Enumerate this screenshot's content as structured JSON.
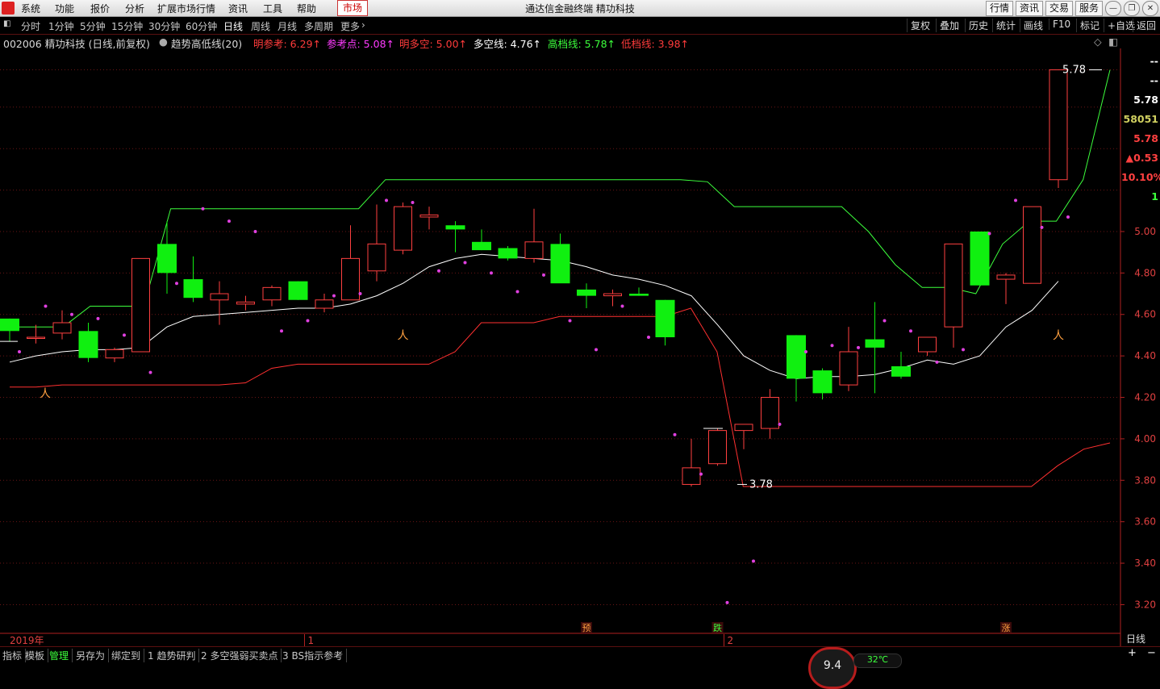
{
  "menubar": {
    "items": [
      "系统",
      "功能",
      "报价",
      "分析",
      "扩展市场行情",
      "资讯",
      "工具",
      "帮助"
    ],
    "market": "市场",
    "title": "通达信金融终端  精功科技",
    "right_buttons": [
      "行情",
      "资讯",
      "交易",
      "服务"
    ]
  },
  "toolbar": {
    "periods": [
      "分时",
      "1分钟",
      "5分钟",
      "15分钟",
      "30分钟",
      "60分钟",
      "日线",
      "周线",
      "月线",
      "多周期",
      "更多"
    ],
    "active_period": "日线",
    "right_items": [
      "复权",
      "叠加",
      "历史",
      "统计",
      "画线",
      "F10",
      "标记",
      "+自选",
      "返回"
    ]
  },
  "infobar": {
    "stock": "002006 精功科技 (日线,前复权)",
    "indicator": "趋势高低线(20)",
    "items": [
      {
        "label": "明参考: 6.29↑",
        "color": "#ff3b3b"
      },
      {
        "label": "参考点: 5.08↑",
        "color": "#ff3bff"
      },
      {
        "label": "明多空: 5.00↑",
        "color": "#ff3b3b"
      },
      {
        "label": "多空线: 4.76↑",
        "color": "#ffffff"
      },
      {
        "label": "高档线: 5.78↑",
        "color": "#3cff3c"
      },
      {
        "label": "低档线: 3.98↑",
        "color": "#ff3b3b"
      }
    ]
  },
  "right_panel": {
    "values": [
      "--",
      "--",
      "5.78",
      "58051",
      "5.78",
      "▲0.53",
      "10.10%",
      "1"
    ],
    "colors": [
      "#ffffff",
      "#ffffff",
      "#ffffff",
      "#d0d060",
      "#ff4040",
      "#ff4040",
      "#ff4040",
      "#3cff3c"
    ]
  },
  "chart_data": {
    "type": "candlestick",
    "ylim": [
      3.12,
      5.86
    ],
    "yticks": [
      "5.00",
      "4.80",
      "4.60",
      "4.40",
      "4.20",
      "4.00",
      "3.80",
      "3.60",
      "3.40",
      "3.20"
    ],
    "ytick_values": [
      5.0,
      4.8,
      4.6,
      4.4,
      4.2,
      4.0,
      3.8,
      3.6,
      3.4,
      3.2
    ],
    "xlabels": [
      "2019年",
      "1",
      "2"
    ],
    "xlabel_candles": [
      0,
      11,
      27
    ],
    "event_markers": [
      {
        "text": "预",
        "candle": 22
      },
      {
        "text": "跌",
        "candle": 27
      },
      {
        "text": "涨",
        "candle": 38
      }
    ],
    "max_label": "5.78",
    "min_label": "3.78",
    "candles": [
      {
        "o": 4.58,
        "h": 4.58,
        "l": 4.47,
        "c": 4.52
      },
      {
        "o": 4.49,
        "h": 4.55,
        "l": 4.46,
        "c": 4.49
      },
      {
        "o": 4.51,
        "h": 4.62,
        "l": 4.48,
        "c": 4.56
      },
      {
        "o": 4.52,
        "h": 4.56,
        "l": 4.37,
        "c": 4.39
      },
      {
        "o": 4.39,
        "h": 4.44,
        "l": 4.37,
        "c": 4.43
      },
      {
        "o": 4.42,
        "h": 4.87,
        "l": 4.42,
        "c": 4.87
      },
      {
        "o": 4.94,
        "h": 5.05,
        "l": 4.7,
        "c": 4.8
      },
      {
        "o": 4.77,
        "h": 4.88,
        "l": 4.66,
        "c": 4.68
      },
      {
        "o": 4.67,
        "h": 4.76,
        "l": 4.55,
        "c": 4.7
      },
      {
        "o": 4.65,
        "h": 4.69,
        "l": 4.62,
        "c": 4.66
      },
      {
        "o": 4.67,
        "h": 4.74,
        "l": 4.64,
        "c": 4.73
      },
      {
        "o": 4.76,
        "h": 4.76,
        "l": 4.67,
        "c": 4.67
      },
      {
        "o": 4.63,
        "h": 4.7,
        "l": 4.61,
        "c": 4.67
      },
      {
        "o": 4.67,
        "h": 5.03,
        "l": 4.67,
        "c": 4.87
      },
      {
        "o": 4.81,
        "h": 5.13,
        "l": 4.76,
        "c": 4.94
      },
      {
        "o": 4.91,
        "h": 5.14,
        "l": 4.89,
        "c": 5.12
      },
      {
        "o": 5.07,
        "h": 5.12,
        "l": 5.01,
        "c": 5.08
      },
      {
        "o": 5.03,
        "h": 5.05,
        "l": 4.9,
        "c": 5.01
      },
      {
        "o": 4.95,
        "h": 5.01,
        "l": 4.91,
        "c": 4.91
      },
      {
        "o": 4.92,
        "h": 4.93,
        "l": 4.86,
        "c": 4.87
      },
      {
        "o": 4.87,
        "h": 5.11,
        "l": 4.85,
        "c": 4.95
      },
      {
        "o": 4.94,
        "h": 4.99,
        "l": 4.77,
        "c": 4.75
      },
      {
        "o": 4.72,
        "h": 4.75,
        "l": 4.63,
        "c": 4.69
      },
      {
        "o": 4.69,
        "h": 4.72,
        "l": 4.64,
        "c": 4.7
      },
      {
        "o": 4.7,
        "h": 4.73,
        "l": 4.69,
        "c": 4.69
      },
      {
        "o": 4.67,
        "h": 4.67,
        "l": 4.45,
        "c": 4.49
      },
      {
        "o": 3.78,
        "h": 4.0,
        "l": 3.77,
        "c": 3.86
      },
      {
        "o": 3.88,
        "h": 4.05,
        "l": 3.87,
        "c": 4.04
      },
      {
        "o": 4.04,
        "h": 4.07,
        "l": 3.95,
        "c": 4.07
      },
      {
        "o": 4.05,
        "h": 4.24,
        "l": 4.0,
        "c": 4.2
      },
      {
        "o": 4.5,
        "h": 4.5,
        "l": 4.18,
        "c": 4.29
      },
      {
        "o": 4.33,
        "h": 4.34,
        "l": 4.19,
        "c": 4.22
      },
      {
        "o": 4.26,
        "h": 4.54,
        "l": 4.23,
        "c": 4.42
      },
      {
        "o": 4.48,
        "h": 4.66,
        "l": 4.22,
        "c": 4.44
      },
      {
        "o": 4.35,
        "h": 4.42,
        "l": 4.29,
        "c": 4.3
      },
      {
        "o": 4.42,
        "h": 4.49,
        "l": 4.4,
        "c": 4.49
      },
      {
        "o": 4.54,
        "h": 4.94,
        "l": 4.44,
        "c": 4.94
      },
      {
        "o": 5.0,
        "h": 5.0,
        "l": 4.74,
        "c": 4.74
      },
      {
        "o": 4.77,
        "h": 4.8,
        "l": 4.65,
        "c": 4.79
      },
      {
        "o": 4.75,
        "h": 5.12,
        "l": 4.75,
        "c": 5.12
      },
      {
        "o": 5.25,
        "h": 5.78,
        "l": 5.21,
        "c": 5.78
      }
    ],
    "series": [
      {
        "key": "mid",
        "color": "#ffffff",
        "values": [
          4.37,
          4.4,
          4.42,
          4.43,
          4.43,
          4.44,
          4.54,
          4.59,
          4.6,
          4.61,
          4.62,
          4.63,
          4.63,
          4.65,
          4.69,
          4.75,
          4.83,
          4.87,
          4.89,
          4.88,
          4.87,
          4.86,
          4.83,
          4.79,
          4.77,
          4.74,
          4.69,
          4.55,
          4.4,
          4.33,
          4.29,
          4.3,
          4.3,
          4.31,
          4.34,
          4.38,
          4.36,
          4.4,
          4.54,
          4.62,
          4.76
        ]
      },
      {
        "key": "high",
        "color": "#3cff3c",
        "values": [
          4.54,
          4.54,
          4.54,
          4.64,
          4.64,
          4.64,
          5.11,
          5.11,
          5.11,
          5.11,
          5.11,
          5.11,
          5.11,
          5.11,
          5.25,
          5.25,
          5.25,
          5.25,
          5.25,
          5.25,
          5.25,
          5.25,
          5.25,
          5.25,
          5.25,
          5.25,
          5.24,
          5.12,
          5.12,
          5.12,
          5.12,
          5.12,
          5.0,
          4.84,
          4.73,
          4.73,
          4.7,
          4.94,
          5.05,
          5.05,
          5.25,
          5.78
        ]
      },
      {
        "key": "low",
        "color": "#ff3030",
        "values": [
          4.25,
          4.25,
          4.26,
          4.26,
          4.26,
          4.26,
          4.26,
          4.26,
          4.26,
          4.27,
          4.34,
          4.36,
          4.36,
          4.36,
          4.36,
          4.36,
          4.36,
          4.42,
          4.56,
          4.56,
          4.56,
          4.59,
          4.59,
          4.59,
          4.59,
          4.59,
          4.63,
          4.42,
          3.77,
          3.77,
          3.77,
          3.77,
          3.77,
          3.77,
          3.77,
          3.77,
          3.77,
          3.77,
          3.77,
          3.77,
          3.87,
          3.95,
          3.98
        ]
      },
      {
        "key": "points",
        "color": "#e040e0",
        "values": [
          4.42,
          4.64,
          4.6,
          4.58,
          4.5,
          4.32,
          4.75,
          5.11,
          5.05,
          5.0,
          4.52,
          4.57,
          4.69,
          4.7,
          5.15,
          5.14,
          4.81,
          4.85,
          4.8,
          4.71,
          4.79,
          4.57,
          4.43,
          4.64,
          4.49,
          4.02,
          3.83,
          3.21,
          3.41,
          4.07,
          4.42,
          4.45,
          4.44,
          4.57,
          4.52,
          4.37,
          4.43,
          4.99,
          5.15,
          5.02,
          5.07
        ]
      }
    ],
    "bs_markers": [
      {
        "candle": 0,
        "value": 4.2
      },
      {
        "candle": 15,
        "value": 4.48
      },
      {
        "candle": 40,
        "value": 4.48
      }
    ]
  },
  "bottombar": {
    "tabs": [
      "指标",
      "模板",
      "管理",
      "另存为",
      "绑定到",
      "1 趋势研判",
      "2 多空强弱买卖点",
      "3 BS指示参考"
    ],
    "active_tab": "管理",
    "period_label": "日线",
    "gauge": "9.4",
    "temp": "32℃"
  }
}
